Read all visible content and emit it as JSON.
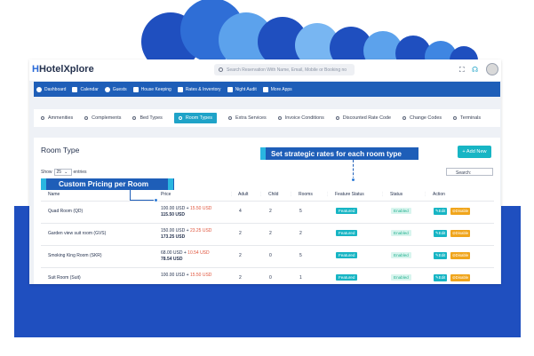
{
  "app": {
    "name_mark": "H",
    "name": "HotelXplore",
    "search_placeholder": "Search Reservation With Name, Email, Mobile or Booking no"
  },
  "icons": {
    "fullscreen": "expand-icon",
    "support": "headset-icon",
    "avatar": "user-avatar"
  },
  "navbar": {
    "items": [
      {
        "label": "Dashboard",
        "icon": "car-icon"
      },
      {
        "label": "Calendar",
        "icon": "calendar-icon"
      },
      {
        "label": "Guests",
        "icon": "user-circle-icon"
      },
      {
        "label": "House Keeping",
        "icon": "door-icon"
      },
      {
        "label": "Rates & Inventory",
        "icon": "calendar-grid-icon"
      },
      {
        "label": "Night Audit",
        "icon": "moon-icon"
      },
      {
        "label": "More Apps",
        "icon": "apps-icon"
      }
    ]
  },
  "tabs": [
    {
      "label": "Ammenities",
      "active": false
    },
    {
      "label": "Complements",
      "active": false
    },
    {
      "label": "Bed Types",
      "active": false
    },
    {
      "label": "Room Types",
      "active": true
    },
    {
      "label": "Extra Services",
      "active": false
    },
    {
      "label": "Invoice Conditions",
      "active": false
    },
    {
      "label": "Discounted Rate Code",
      "active": false
    },
    {
      "label": "Change Codes",
      "active": false
    },
    {
      "label": "Terminals",
      "active": false
    }
  ],
  "card": {
    "title": "Room Type",
    "add_button": "+ Add New",
    "show_prefix": "Show",
    "show_value": "25",
    "show_suffix": "entries",
    "search_label": "Search:"
  },
  "table": {
    "columns": [
      "Name",
      "Price",
      "Adult",
      "Child",
      "Rooms",
      "Feature Status",
      "Status",
      "Action"
    ],
    "rows": [
      {
        "name": "Quad Room (QD)",
        "base": "100.00 USD +",
        "extra": "15.50 USD",
        "total": "115.50 USD",
        "adult": "4",
        "child": "2",
        "rooms": "5",
        "feature": "Featured",
        "status": "Enabled",
        "edit": "✎Edit",
        "disable": "⊘Disable"
      },
      {
        "name": "Garden view suit room (GVS)",
        "base": "150.00 USD +",
        "extra": "23.25 USD",
        "total": "173.25 USD",
        "adult": "2",
        "child": "2",
        "rooms": "2",
        "feature": "Featured",
        "status": "Enabled",
        "edit": "✎Edit",
        "disable": "⊘Disable"
      },
      {
        "name": "Smoking King Room (SKR)",
        "base": "68.00 USD +",
        "extra": "10.54 USD",
        "total": "78.54 USD",
        "adult": "2",
        "child": "0",
        "rooms": "5",
        "feature": "Featured",
        "status": "Enabled",
        "edit": "✎Edit",
        "disable": "⊘Disable"
      },
      {
        "name": "Suit Room (Suit)",
        "base": "100.00 USD +",
        "extra": "15.50 USD",
        "total": "",
        "adult": "2",
        "child": "0",
        "rooms": "1",
        "feature": "Featured",
        "status": "Enabled",
        "edit": "✎Edit",
        "disable": "⊘Disable"
      }
    ]
  },
  "callouts": {
    "rates": "Set strategic rates for each room type",
    "pricing": "Custom Pricing per Room"
  },
  "colors": {
    "brand": "#1e5eb8",
    "accent": "#17b5c4",
    "background_band": "#1f4fbf",
    "extra_price": "#e0553d",
    "disable": "#f0a51c"
  }
}
